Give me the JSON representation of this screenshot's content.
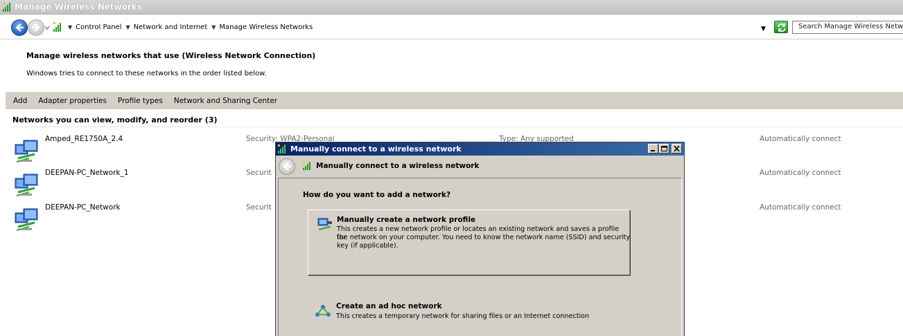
{
  "window": {
    "title": "Manage Wireless Networks"
  },
  "address": {
    "breadcrumbs": [
      "Control Panel",
      "Network and Internet",
      "Manage Wireless Networks"
    ],
    "search_placeholder": "Search Manage Wireless Networks"
  },
  "header": {
    "title": "Manage wireless networks that use (Wireless Network Connection)",
    "subtitle": "Windows tries to connect to these networks in the order listed below."
  },
  "commands": [
    "Add",
    "Adapter properties",
    "Profile types",
    "Network and Sharing Center"
  ],
  "group": {
    "label": "Networks you can view, modify, and reorder (3)"
  },
  "networks": [
    {
      "name": "Amped_RE1750A_2.4",
      "security": "Security: WPA2-Personal",
      "type": "Type: Any supported",
      "mode": "Automatically connect"
    },
    {
      "name": "DEEPAN-PC_Network_1",
      "security": "Securit",
      "type": "",
      "mode": "Automatically connect"
    },
    {
      "name": "DEEPAN-PC_Network",
      "security": "Securit",
      "type": "",
      "mode": "Automatically connect"
    }
  ],
  "dialog": {
    "title": "Manually connect to a wireless network",
    "nav_title": "Manually connect to a wireless network",
    "question": "How do you want to add a network?",
    "options": [
      {
        "title": "Manually create a network profile",
        "description_lines": [
          "This creates a new network profile or locates an existing network and saves a profile for",
          "the network on your computer. You need to know the network name (SSID) and security",
          "key (if applicable)."
        ]
      },
      {
        "title": "Create an ad hoc network",
        "description_lines": [
          "This creates a temporary network for sharing files or an Internet connection"
        ]
      }
    ]
  },
  "colors": {
    "dialog_title_start": "#0a246a",
    "dialog_title_end": "#3a6ea5",
    "classic_face": "#d4d0c8"
  }
}
